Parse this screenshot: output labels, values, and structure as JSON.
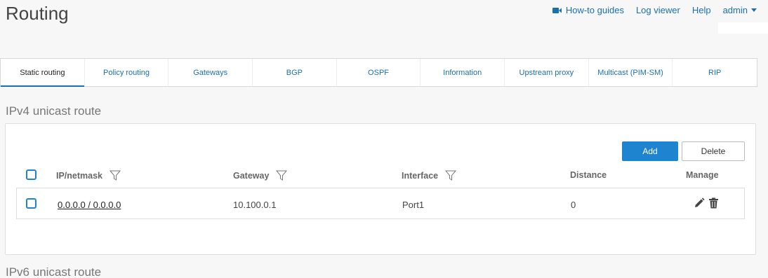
{
  "page": {
    "title": "Routing"
  },
  "header": {
    "links": {
      "howto": "How-to guides",
      "logviewer": "Log viewer",
      "help": "Help",
      "user": "admin"
    }
  },
  "tabs": [
    {
      "label": "Static routing",
      "active": true
    },
    {
      "label": "Policy routing"
    },
    {
      "label": "Gateways"
    },
    {
      "label": "BGP"
    },
    {
      "label": "OSPF"
    },
    {
      "label": "Information"
    },
    {
      "label": "Upstream proxy"
    },
    {
      "label": "Multicast (PIM-SM)"
    },
    {
      "label": "RIP"
    }
  ],
  "ipv4": {
    "title": "IPv4 unicast route",
    "actions": {
      "add": "Add",
      "delete": "Delete"
    },
    "columns": {
      "ip": "IP/netmask",
      "gateway": "Gateway",
      "interface": "Interface",
      "distance": "Distance",
      "manage": "Manage"
    },
    "rows": [
      {
        "ip": "0.0.0.0 / 0.0.0.0",
        "gateway": "10.100.0.1",
        "interface": "Port1",
        "distance": "0"
      }
    ]
  },
  "ipv6": {
    "title": "IPv6 unicast route"
  },
  "colors": {
    "accent": "#1f84d0",
    "link": "#1a6fb0"
  },
  "icons": [
    "video-camera-icon",
    "caret-down-icon",
    "filter-icon",
    "edit-pencil-icon",
    "trash-icon"
  ]
}
